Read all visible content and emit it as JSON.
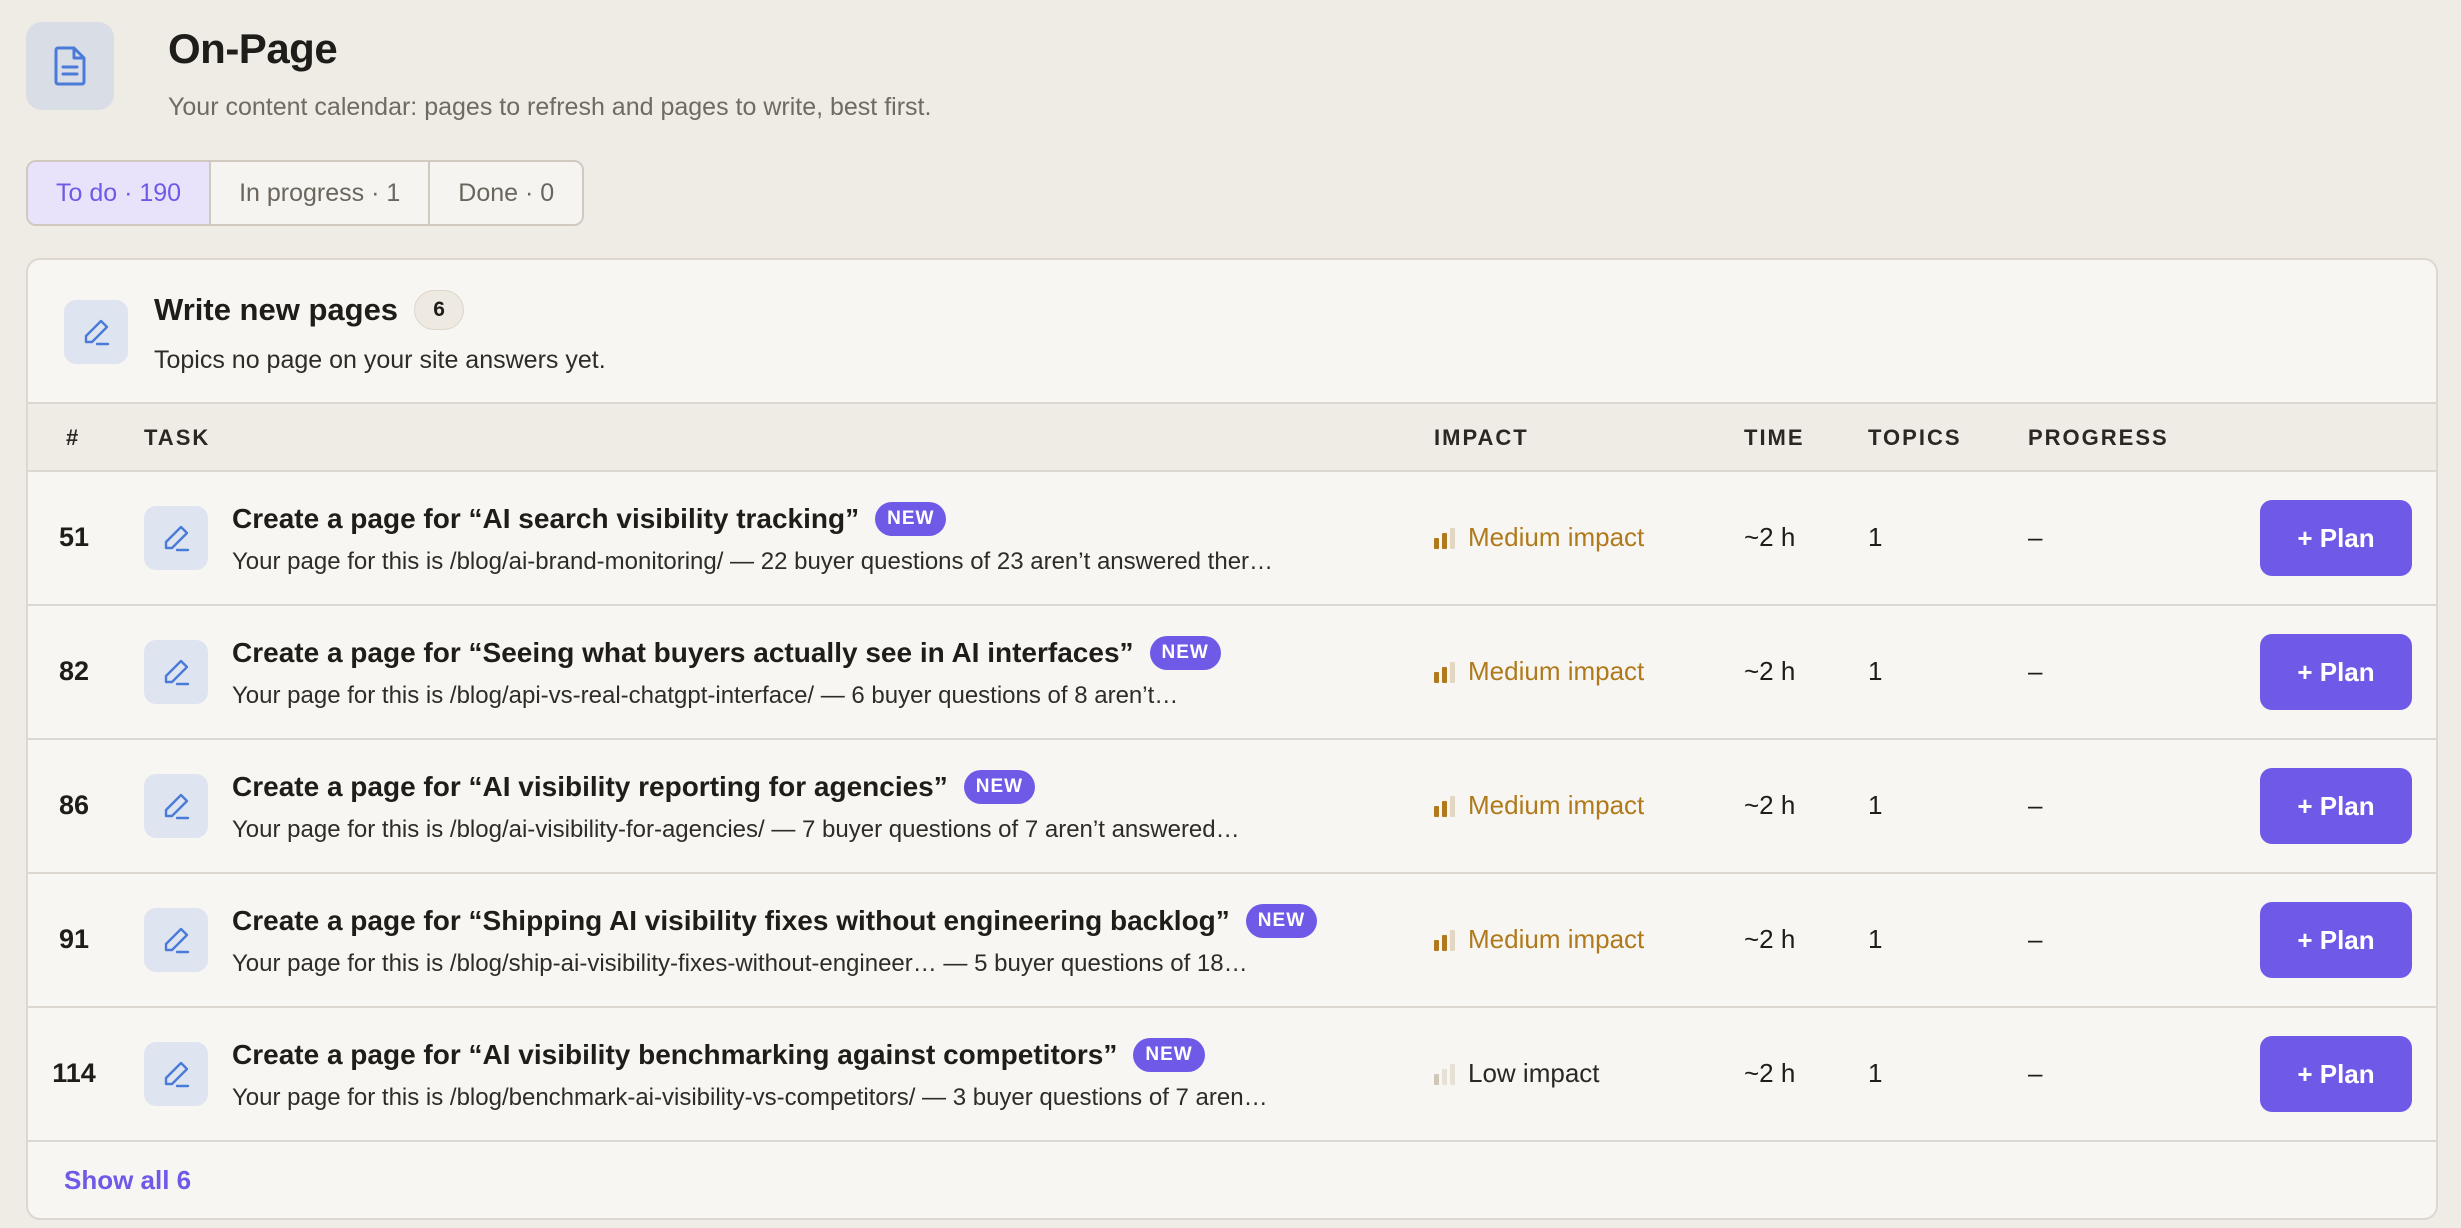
{
  "header": {
    "title": "On-Page",
    "subtitle": "Your content calendar: pages to refresh and pages to write, best first.",
    "icon": "document-icon"
  },
  "tabs": [
    {
      "label": "To do · 190",
      "active": true
    },
    {
      "label": "In progress · 1",
      "active": false
    },
    {
      "label": "Done · 0",
      "active": false
    }
  ],
  "section": {
    "title": "Write new pages",
    "count": "6",
    "subtitle": "Topics no page on your site answers yet.",
    "icon": "pencil-icon"
  },
  "columns": {
    "num": "#",
    "task": "TASK",
    "impact": "IMPACT",
    "time": "TIME",
    "topics": "TOPICS",
    "progress": "PROGRESS"
  },
  "rows": [
    {
      "num": "51",
      "title": "Create a page for “AI search visibility tracking”",
      "badge": "NEW",
      "desc": "Your page for this is /blog/ai-brand-monitoring/ — 22 buyer questions of 23 aren’t answered ther…",
      "impact": "Medium impact",
      "time": "~2 h",
      "topics": "1",
      "progress": "–",
      "action": "+ Plan"
    },
    {
      "num": "82",
      "title": "Create a page for “Seeing what buyers actually see in AI interfaces”",
      "badge": "NEW",
      "desc": "Your page for this is /blog/api-vs-real-chatgpt-interface/ — 6 buyer questions of 8 aren’t…",
      "impact": "Medium impact",
      "time": "~2 h",
      "topics": "1",
      "progress": "–",
      "action": "+ Plan"
    },
    {
      "num": "86",
      "title": "Create a page for “AI visibility reporting for agencies”",
      "badge": "NEW",
      "desc": "Your page for this is /blog/ai-visibility-for-agencies/ — 7 buyer questions of 7 aren’t answered…",
      "impact": "Medium impact",
      "time": "~2 h",
      "topics": "1",
      "progress": "–",
      "action": "+ Plan"
    },
    {
      "num": "91",
      "title": "Create a page for “Shipping AI visibility fixes without engineering backlog”",
      "badge": "NEW",
      "desc": "Your page for this is /blog/ship-ai-visibility-fixes-without-engineer… — 5 buyer questions of 18…",
      "impact": "Medium impact",
      "time": "~2 h",
      "topics": "1",
      "progress": "–",
      "action": "+ Plan"
    },
    {
      "num": "114",
      "title": "Create a page for “AI visibility benchmarking against competitors”",
      "badge": "NEW",
      "desc": "Your page for this is /blog/benchmark-ai-visibility-vs-competitors/ — 3 buyer questions of 7 aren…",
      "impact": "Low impact",
      "time": "~2 h",
      "topics": "1",
      "progress": "–",
      "action": "+ Plan"
    }
  ],
  "footer": {
    "show_all": "Show all 6"
  },
  "colors": {
    "accent": "#6f5ae8",
    "medium_impact": "#b07a1c",
    "background": "#efebe5"
  }
}
